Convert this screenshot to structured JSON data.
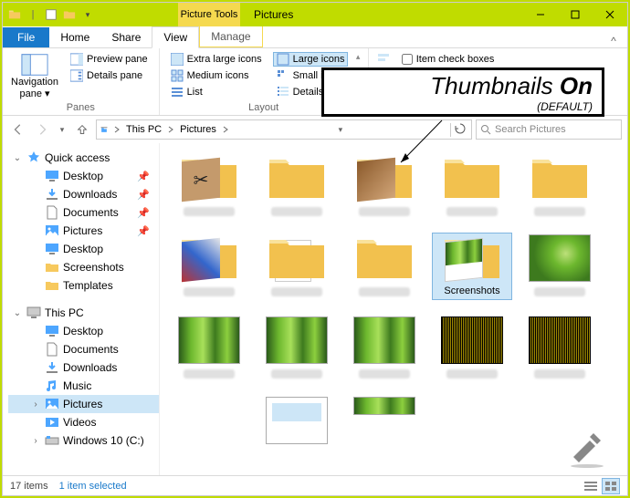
{
  "title": {
    "context_tab": "Picture Tools",
    "window_title": "Pictures"
  },
  "win_ctl": {
    "min": "Minimize",
    "max": "Maximize",
    "close": "Close"
  },
  "tabs": {
    "file": "File",
    "home": "Home",
    "share": "Share",
    "view": "View",
    "manage": "Manage"
  },
  "ribbon": {
    "panes": {
      "nav": "Navigation pane",
      "preview": "Preview pane",
      "details": "Details pane",
      "group": "Panes"
    },
    "layout": {
      "xl": "Extra large icons",
      "lg": "Large icons",
      "md": "Medium icons",
      "sm": "Small icons",
      "list": "List",
      "det": "Details",
      "group": "Layout"
    },
    "show": {
      "item_chk": "Item check boxes"
    }
  },
  "address": {
    "this_pc": "This PC",
    "pictures": "Pictures"
  },
  "search": {
    "placeholder": "Search Pictures"
  },
  "sidebar": {
    "quick": "Quick access",
    "desktop": "Desktop",
    "downloads": "Downloads",
    "documents": "Documents",
    "pictures": "Pictures",
    "desktop2": "Desktop",
    "screenshots": "Screenshots",
    "templates": "Templates",
    "thispc": "This PC",
    "pc_desktop": "Desktop",
    "pc_documents": "Documents",
    "pc_downloads": "Downloads",
    "pc_music": "Music",
    "pc_pictures": "Pictures",
    "pc_videos": "Videos",
    "pc_c": "Windows 10 (C:)"
  },
  "items": {
    "screenshots": "Screenshots"
  },
  "status": {
    "count": "17 items",
    "selected": "1 item selected"
  },
  "annot": {
    "t1": "Thumbnails ",
    "t1b": "On",
    "t2": "(DEFAULT)"
  }
}
